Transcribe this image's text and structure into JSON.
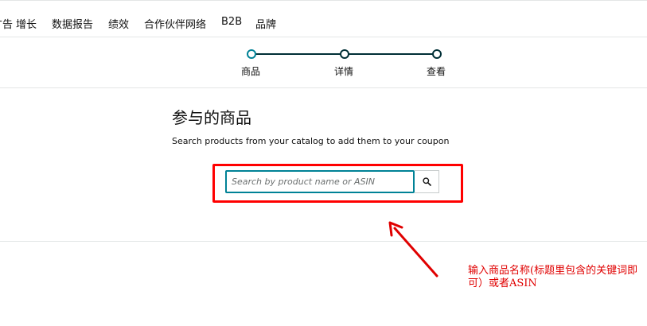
{
  "nav": {
    "items": [
      {
        "label": "广告"
      },
      {
        "label": "增长"
      },
      {
        "label": "数据报告"
      },
      {
        "label": "绩效"
      },
      {
        "label": "合作伙伴网络"
      },
      {
        "label": "B2B"
      },
      {
        "label": "品牌"
      }
    ]
  },
  "stepper": {
    "steps": [
      {
        "label": "商品",
        "state": "current"
      },
      {
        "label": "详情",
        "state": "upcoming"
      },
      {
        "label": "查看",
        "state": "upcoming"
      }
    ],
    "line_color": "#002f36",
    "active_color": "#008296"
  },
  "main": {
    "title": "参与的商品",
    "subtitle": "Search products from your catalog to add them to your coupon",
    "search": {
      "placeholder": "Search by product name or ASIN",
      "value": "",
      "button_icon": "search-icon"
    }
  },
  "annotation": {
    "text": "输入商品名称(标题里包含的关键词即可）或者ASIN",
    "color": "#e00000",
    "highlight_color": "#ff0000"
  }
}
